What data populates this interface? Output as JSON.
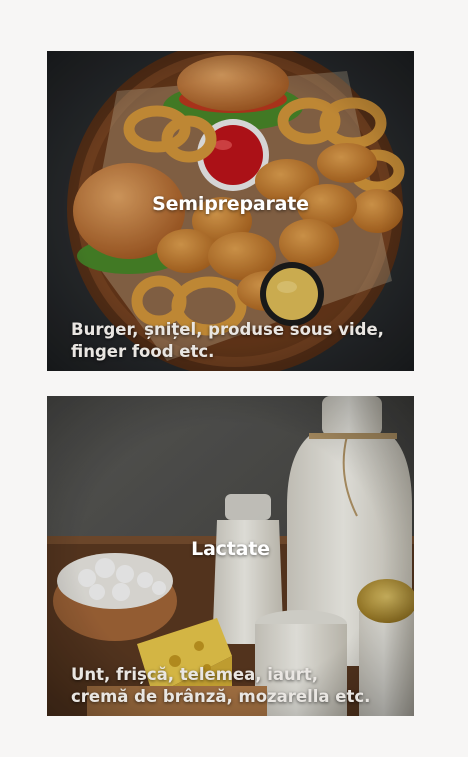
{
  "categories": [
    {
      "title": "Semipreparate",
      "description_lines": [
        "Burger, șnițel, produse sous vide,",
        "finger food etc."
      ],
      "image": "burger-nuggets-platter-image"
    },
    {
      "title": "Lactate",
      "description_lines": [
        "Unt, frișcă, telemea, iaurt,",
        "cremă de brânză, mozarella etc."
      ],
      "image": "dairy-products-image"
    }
  ]
}
